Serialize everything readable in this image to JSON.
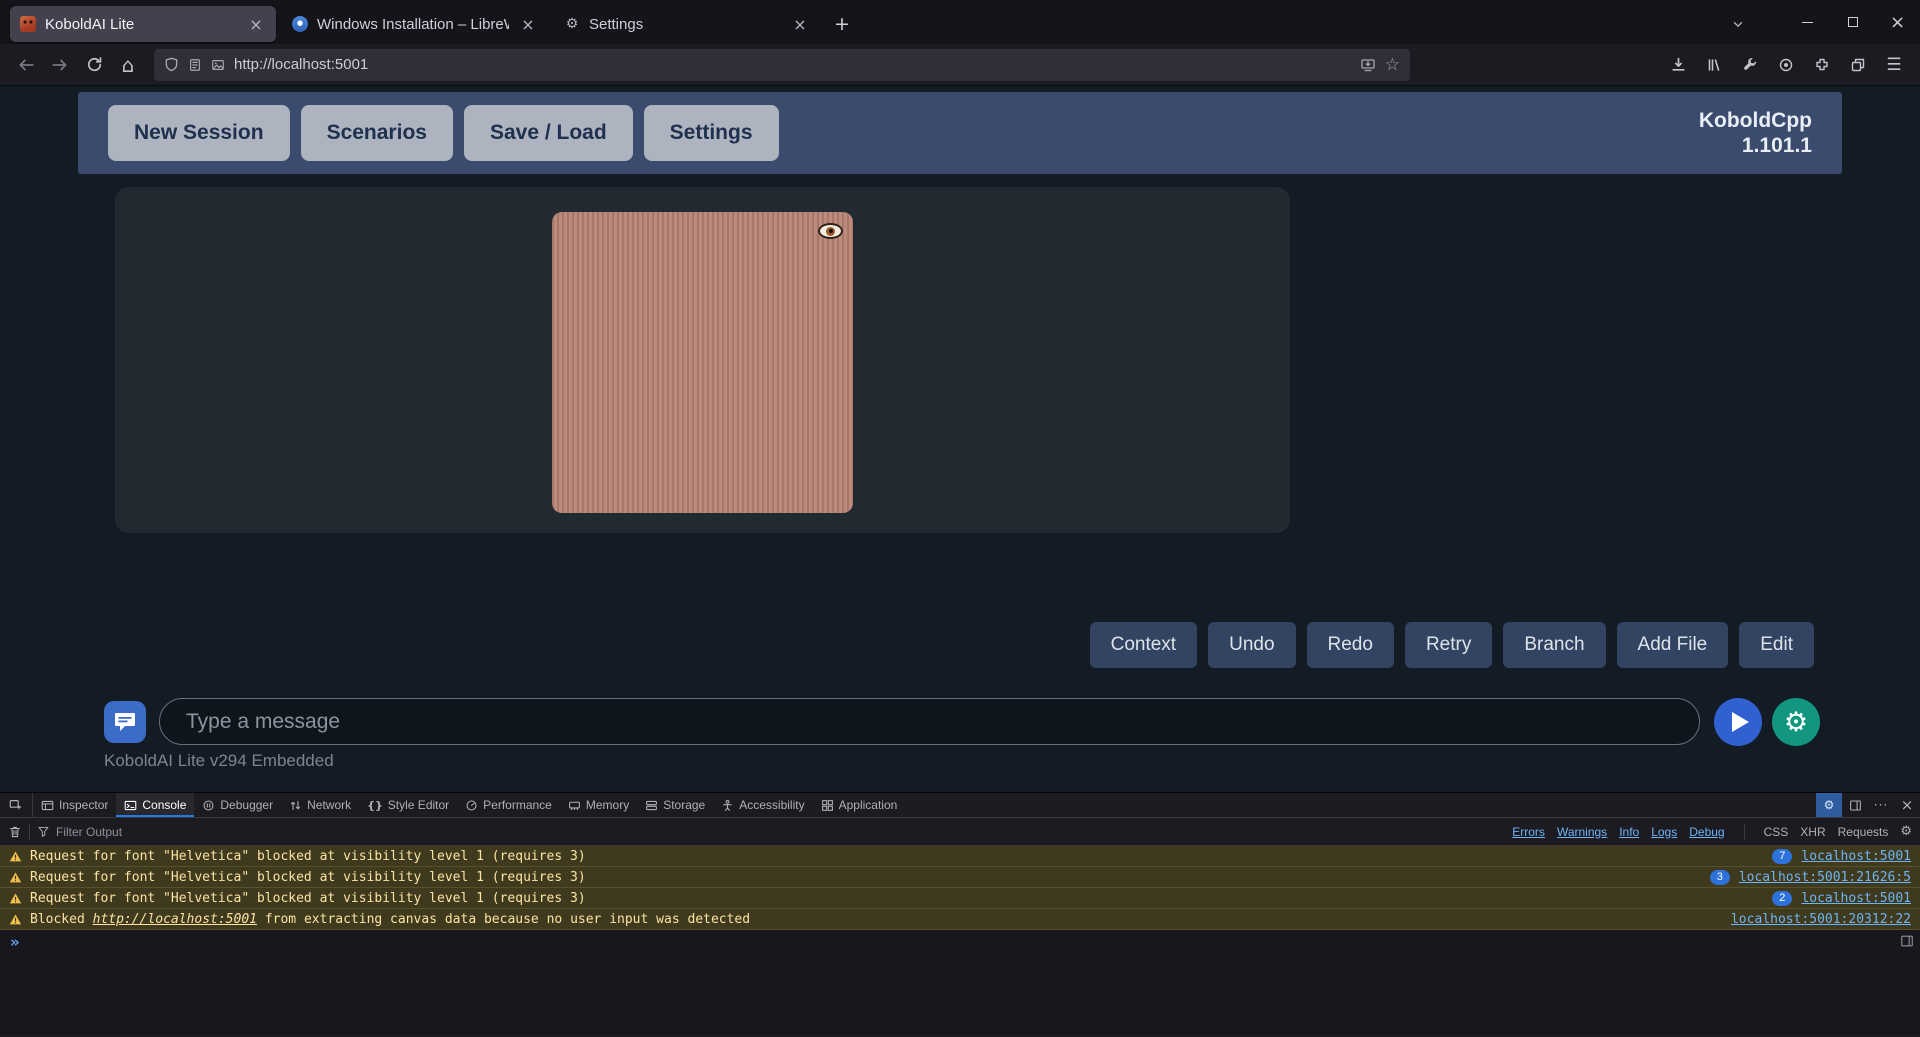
{
  "browser": {
    "tabs": [
      {
        "title": "KoboldAI Lite"
      },
      {
        "title": "Windows Installation – LibreWo"
      },
      {
        "title": "Settings"
      }
    ],
    "url": "http://localhost:5001"
  },
  "icons": {
    "home": "⌂",
    "star": "☆",
    "hamburger": "☰",
    "gear": "⚙",
    "braces": "{}",
    "close": "×",
    "plus": "+",
    "overflow": "···",
    "prompt": "»"
  },
  "app": {
    "menu": [
      {
        "label": "New Session"
      },
      {
        "label": "Scenarios"
      },
      {
        "label": "Save / Load"
      },
      {
        "label": "Settings"
      }
    ],
    "brand": {
      "line1": "KoboldCpp",
      "line2": "1.101.1"
    },
    "actions": [
      {
        "label": "Context"
      },
      {
        "label": "Undo"
      },
      {
        "label": "Redo"
      },
      {
        "label": "Retry"
      },
      {
        "label": "Branch"
      },
      {
        "label": "Add File"
      },
      {
        "label": "Edit"
      }
    ],
    "input": {
      "placeholder": "Type a message"
    },
    "footer": "KoboldAI Lite v294 Embedded",
    "colors": {
      "accent_blue": "#3161d1",
      "accent_teal": "#129680",
      "header": "#3a4b6d",
      "image": "#bd8a7c"
    }
  },
  "devtools": {
    "tabs": [
      {
        "label": "Inspector"
      },
      {
        "label": "Console"
      },
      {
        "label": "Debugger"
      },
      {
        "label": "Network"
      },
      {
        "label": "Style Editor"
      },
      {
        "label": "Performance"
      },
      {
        "label": "Memory"
      },
      {
        "label": "Storage"
      },
      {
        "label": "Accessibility"
      },
      {
        "label": "Application"
      }
    ],
    "filter": {
      "placeholder": "Filter Output"
    },
    "level_filters": [
      {
        "label": "Errors"
      },
      {
        "label": "Warnings"
      },
      {
        "label": "Info"
      },
      {
        "label": "Logs"
      },
      {
        "label": "Debug"
      }
    ],
    "type_filters": [
      {
        "label": "CSS"
      },
      {
        "label": "XHR"
      },
      {
        "label": "Requests"
      }
    ],
    "messages": [
      {
        "text": "Request for font \"Helvetica\" blocked at visibility level 1 (requires 3)",
        "count": "7",
        "source": "localhost:5001"
      },
      {
        "text": "Request for font \"Helvetica\" blocked at visibility level 1 (requires 3)",
        "count": "3",
        "source": "localhost:5001:21626:5"
      },
      {
        "text": "Request for font \"Helvetica\" blocked at visibility level 1 (requires 3)",
        "count": "2",
        "source": "localhost:5001"
      },
      {
        "prefix": "Blocked ",
        "link": "http://localhost:5001",
        "suffix": " from extracting canvas data because no user input was detected",
        "source": "localhost:5001:20312:22"
      }
    ],
    "colors": {
      "warning_bg": "#3f3a1d",
      "link_blue": "#6eb4f5",
      "badge_blue": "#2d72db"
    }
  }
}
